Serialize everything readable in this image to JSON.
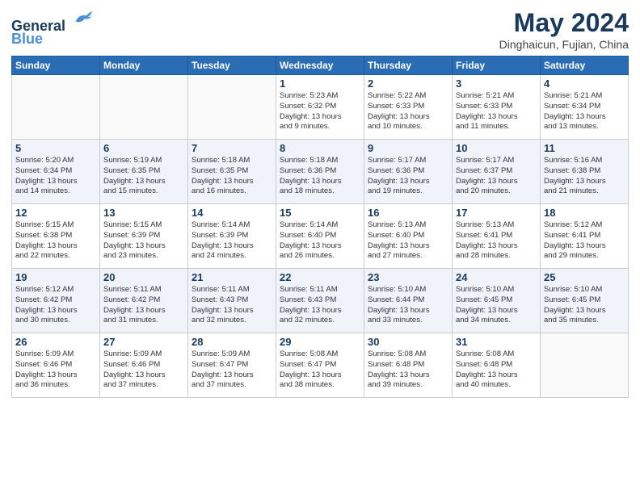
{
  "header": {
    "logo_line1": "General",
    "logo_line2": "Blue",
    "month_year": "May 2024",
    "location": "Dinghaicun, Fujian, China"
  },
  "weekdays": [
    "Sunday",
    "Monday",
    "Tuesday",
    "Wednesday",
    "Thursday",
    "Friday",
    "Saturday"
  ],
  "weeks": [
    [
      {
        "day": "",
        "info": ""
      },
      {
        "day": "",
        "info": ""
      },
      {
        "day": "",
        "info": ""
      },
      {
        "day": "1",
        "info": "Sunrise: 5:23 AM\nSunset: 6:32 PM\nDaylight: 13 hours\nand 9 minutes."
      },
      {
        "day": "2",
        "info": "Sunrise: 5:22 AM\nSunset: 6:33 PM\nDaylight: 13 hours\nand 10 minutes."
      },
      {
        "day": "3",
        "info": "Sunrise: 5:21 AM\nSunset: 6:33 PM\nDaylight: 13 hours\nand 11 minutes."
      },
      {
        "day": "4",
        "info": "Sunrise: 5:21 AM\nSunset: 6:34 PM\nDaylight: 13 hours\nand 13 minutes."
      }
    ],
    [
      {
        "day": "5",
        "info": "Sunrise: 5:20 AM\nSunset: 6:34 PM\nDaylight: 13 hours\nand 14 minutes."
      },
      {
        "day": "6",
        "info": "Sunrise: 5:19 AM\nSunset: 6:35 PM\nDaylight: 13 hours\nand 15 minutes."
      },
      {
        "day": "7",
        "info": "Sunrise: 5:18 AM\nSunset: 6:35 PM\nDaylight: 13 hours\nand 16 minutes."
      },
      {
        "day": "8",
        "info": "Sunrise: 5:18 AM\nSunset: 6:36 PM\nDaylight: 13 hours\nand 18 minutes."
      },
      {
        "day": "9",
        "info": "Sunrise: 5:17 AM\nSunset: 6:36 PM\nDaylight: 13 hours\nand 19 minutes."
      },
      {
        "day": "10",
        "info": "Sunrise: 5:17 AM\nSunset: 6:37 PM\nDaylight: 13 hours\nand 20 minutes."
      },
      {
        "day": "11",
        "info": "Sunrise: 5:16 AM\nSunset: 6:38 PM\nDaylight: 13 hours\nand 21 minutes."
      }
    ],
    [
      {
        "day": "12",
        "info": "Sunrise: 5:15 AM\nSunset: 6:38 PM\nDaylight: 13 hours\nand 22 minutes."
      },
      {
        "day": "13",
        "info": "Sunrise: 5:15 AM\nSunset: 6:39 PM\nDaylight: 13 hours\nand 23 minutes."
      },
      {
        "day": "14",
        "info": "Sunrise: 5:14 AM\nSunset: 6:39 PM\nDaylight: 13 hours\nand 24 minutes."
      },
      {
        "day": "15",
        "info": "Sunrise: 5:14 AM\nSunset: 6:40 PM\nDaylight: 13 hours\nand 26 minutes."
      },
      {
        "day": "16",
        "info": "Sunrise: 5:13 AM\nSunset: 6:40 PM\nDaylight: 13 hours\nand 27 minutes."
      },
      {
        "day": "17",
        "info": "Sunrise: 5:13 AM\nSunset: 6:41 PM\nDaylight: 13 hours\nand 28 minutes."
      },
      {
        "day": "18",
        "info": "Sunrise: 5:12 AM\nSunset: 6:41 PM\nDaylight: 13 hours\nand 29 minutes."
      }
    ],
    [
      {
        "day": "19",
        "info": "Sunrise: 5:12 AM\nSunset: 6:42 PM\nDaylight: 13 hours\nand 30 minutes."
      },
      {
        "day": "20",
        "info": "Sunrise: 5:11 AM\nSunset: 6:42 PM\nDaylight: 13 hours\nand 31 minutes."
      },
      {
        "day": "21",
        "info": "Sunrise: 5:11 AM\nSunset: 6:43 PM\nDaylight: 13 hours\nand 32 minutes."
      },
      {
        "day": "22",
        "info": "Sunrise: 5:11 AM\nSunset: 6:43 PM\nDaylight: 13 hours\nand 32 minutes."
      },
      {
        "day": "23",
        "info": "Sunrise: 5:10 AM\nSunset: 6:44 PM\nDaylight: 13 hours\nand 33 minutes."
      },
      {
        "day": "24",
        "info": "Sunrise: 5:10 AM\nSunset: 6:45 PM\nDaylight: 13 hours\nand 34 minutes."
      },
      {
        "day": "25",
        "info": "Sunrise: 5:10 AM\nSunset: 6:45 PM\nDaylight: 13 hours\nand 35 minutes."
      }
    ],
    [
      {
        "day": "26",
        "info": "Sunrise: 5:09 AM\nSunset: 6:46 PM\nDaylight: 13 hours\nand 36 minutes."
      },
      {
        "day": "27",
        "info": "Sunrise: 5:09 AM\nSunset: 6:46 PM\nDaylight: 13 hours\nand 37 minutes."
      },
      {
        "day": "28",
        "info": "Sunrise: 5:09 AM\nSunset: 6:47 PM\nDaylight: 13 hours\nand 37 minutes."
      },
      {
        "day": "29",
        "info": "Sunrise: 5:08 AM\nSunset: 6:47 PM\nDaylight: 13 hours\nand 38 minutes."
      },
      {
        "day": "30",
        "info": "Sunrise: 5:08 AM\nSunset: 6:48 PM\nDaylight: 13 hours\nand 39 minutes."
      },
      {
        "day": "31",
        "info": "Sunrise: 5:08 AM\nSunset: 6:48 PM\nDaylight: 13 hours\nand 40 minutes."
      },
      {
        "day": "",
        "info": ""
      }
    ]
  ]
}
